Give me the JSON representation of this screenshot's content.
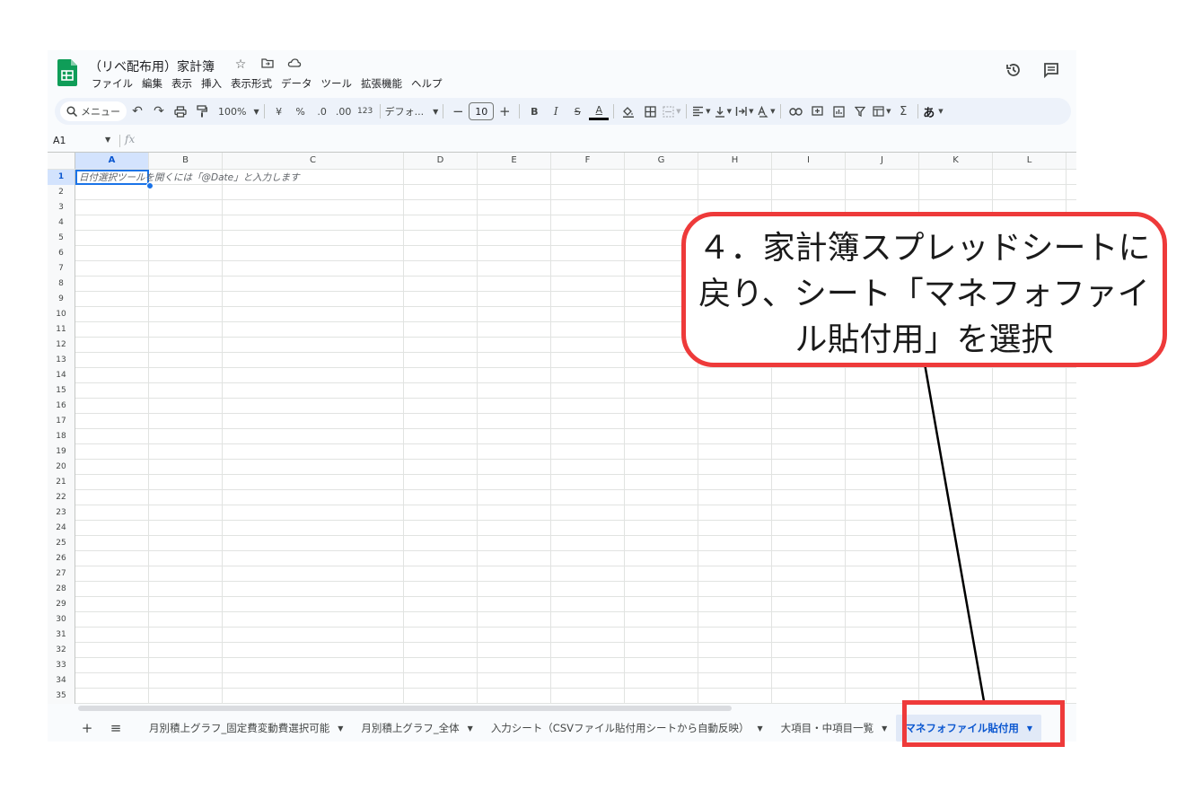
{
  "doc": {
    "title": "（リベ配布用）家計簿",
    "menus": [
      "ファイル",
      "編集",
      "表示",
      "挿入",
      "表示形式",
      "データ",
      "ツール",
      "拡張機能",
      "ヘルプ"
    ]
  },
  "toolbar": {
    "search_label": "メニュー",
    "zoom": "100%",
    "currency": "¥",
    "percent": "%",
    "dec_less": ".0",
    "dec_more": ".00",
    "number_format": "123",
    "font": "デフォ...",
    "font_size": "10",
    "bold": "B",
    "italic": "I",
    "strike": "S",
    "text_color": "A",
    "sum": "Σ",
    "input_mode": "あ"
  },
  "formula_bar": {
    "name_box": "A1",
    "fx": "fx"
  },
  "grid": {
    "columns": [
      "A",
      "B",
      "C",
      "D",
      "E",
      "F",
      "G",
      "H",
      "I",
      "J",
      "K",
      "L"
    ],
    "rows": [
      "1",
      "2",
      "3",
      "4",
      "5",
      "6",
      "7",
      "8",
      "9",
      "10",
      "11",
      "12",
      "13",
      "14",
      "15",
      "16",
      "17",
      "18",
      "19",
      "20",
      "21",
      "22",
      "23",
      "24",
      "25",
      "26",
      "27",
      "28",
      "29",
      "30",
      "31",
      "32",
      "33",
      "34",
      "35"
    ],
    "a1_hint": "日付選択ツールを開くには「@Date」と入力します",
    "selected_cell": "A1"
  },
  "sheets": {
    "add": "+",
    "list": "≡",
    "tabs": [
      {
        "label": "月別積上グラフ_固定費変動費選択可能",
        "active": false
      },
      {
        "label": "月別積上グラフ_全体",
        "active": false
      },
      {
        "label": "入力シート（CSVファイル貼付用シートから自動反映）",
        "active": false
      },
      {
        "label": "大項目・中項目一覧",
        "active": false
      },
      {
        "label": "マネフォファイル貼付用",
        "active": true
      }
    ]
  },
  "annotation": {
    "line1": "４．家計簿スプレッドシートに",
    "line2": "戻り、シート「マネフォファイ",
    "line3": "ル貼付用」を選択",
    "color": "#ee3a3a"
  },
  "colors": {
    "accent": "#0b57d0",
    "selection": "#1a73e8",
    "sheets_green": "#0f9d58"
  }
}
